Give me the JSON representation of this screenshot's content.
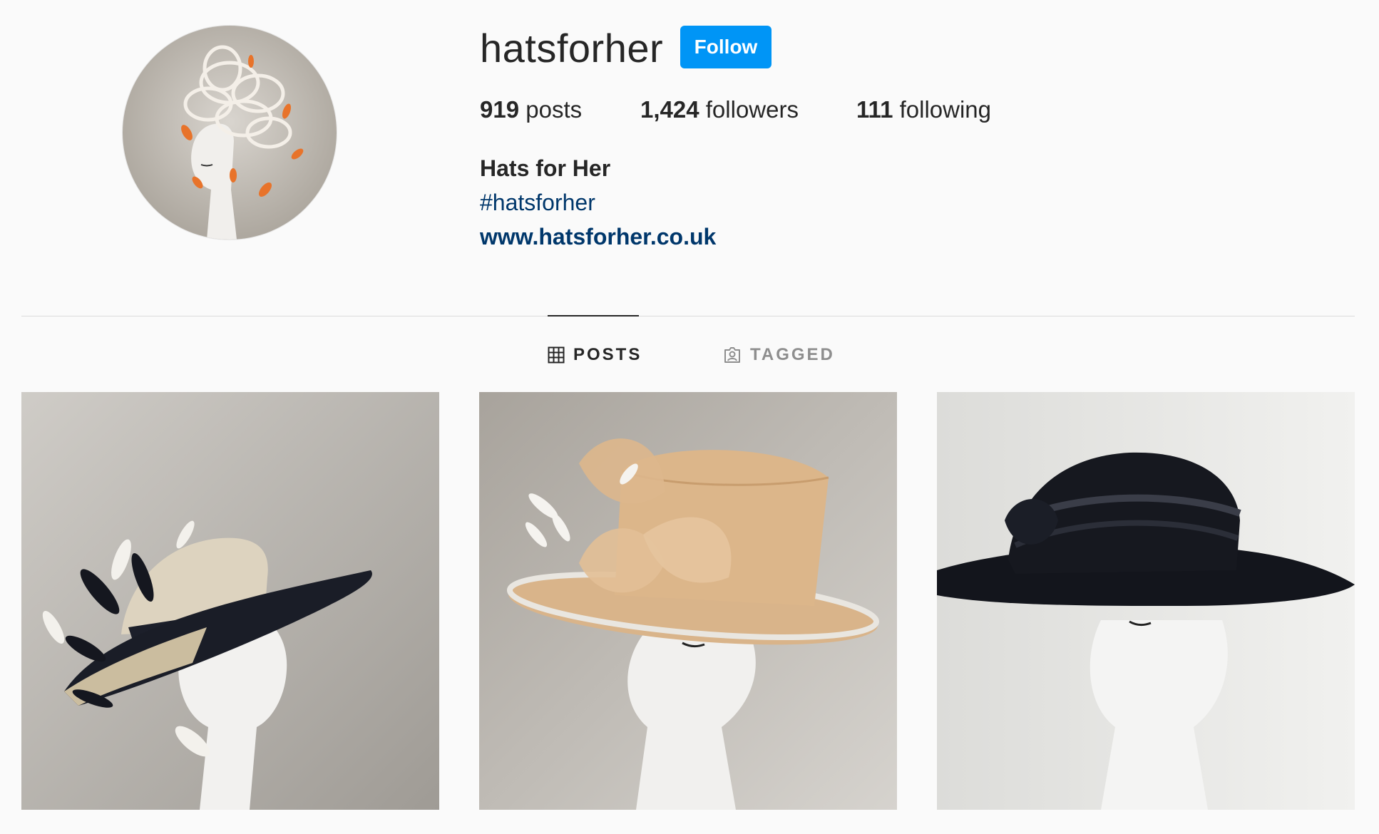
{
  "profile": {
    "username": "hatsforher",
    "follow_label": "Follow",
    "stats": {
      "posts_count": "919",
      "posts_label": "posts",
      "followers_count": "1,424",
      "followers_label": "followers",
      "following_count": "111",
      "following_label": "following"
    },
    "bio": {
      "name": "Hats for Her",
      "hashtag": "#hatsforher",
      "website": "www.hatsforher.co.uk"
    }
  },
  "tabs": [
    {
      "label": "POSTS",
      "icon": "grid-icon",
      "active": true
    },
    {
      "label": "TAGGED",
      "icon": "tagged-icon",
      "active": false
    }
  ],
  "posts": [
    {
      "image": "black-cream-sinamay-hat-feathers"
    },
    {
      "image": "peach-sinamay-hat-loops"
    },
    {
      "image": "black-wide-brim-satin-hat"
    }
  ],
  "colors": {
    "accent": "#0095f6",
    "link": "#00376b",
    "text": "#262626",
    "muted": "#8e8e8e",
    "background": "#fafafa",
    "divider": "#dbdbdb"
  }
}
